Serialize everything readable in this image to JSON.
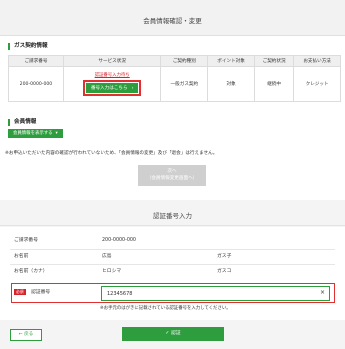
{
  "page": {
    "title": "会員情報確認・変更"
  },
  "gas_section": {
    "title": "ガス契約情報",
    "columns": [
      "ご請求番号",
      "サービス状況",
      "ご契約種別",
      "ポイント対象",
      "ご契約状況",
      "お支払い方法"
    ],
    "row": {
      "billing_number": "200-0000-000",
      "service_link": "認証番号入力待ち",
      "service_button": "番号入力はこちら",
      "contract_type": "一般ガス契約",
      "points": "対象",
      "status": "継続中",
      "payment": "クレジット"
    }
  },
  "member_section": {
    "title": "会員情報",
    "show_button": "会員情報を表示する",
    "note": "※お申込いただいた内容の確認が行われていないため、「会員情報の変更」及び「退会」は行えません。",
    "next_button_line1": "次へ",
    "next_button_line2": "（会員情報変更画面へ）"
  },
  "auth_section": {
    "title": "認証番号入力",
    "rows": [
      {
        "label": "ご請求番号",
        "value1": "200-0000-000",
        "value2": ""
      },
      {
        "label": "お名前",
        "value1": "広島",
        "value2": "ガス子"
      },
      {
        "label": "お名前（カナ）",
        "value1": "ヒロシマ",
        "value2": "ガスコ"
      }
    ],
    "required_badge": "必須",
    "code_label": "認証番号",
    "code_value": "12345678",
    "clear_icon": "×",
    "hint": "※お手元のはがきに記載されている認証番号を入力してください。",
    "back_button": "戻る",
    "back_icon": "←",
    "ok_button": "認証",
    "ok_icon": "✓"
  },
  "icons": {
    "chevron": "›",
    "chevron_down": "▾"
  }
}
